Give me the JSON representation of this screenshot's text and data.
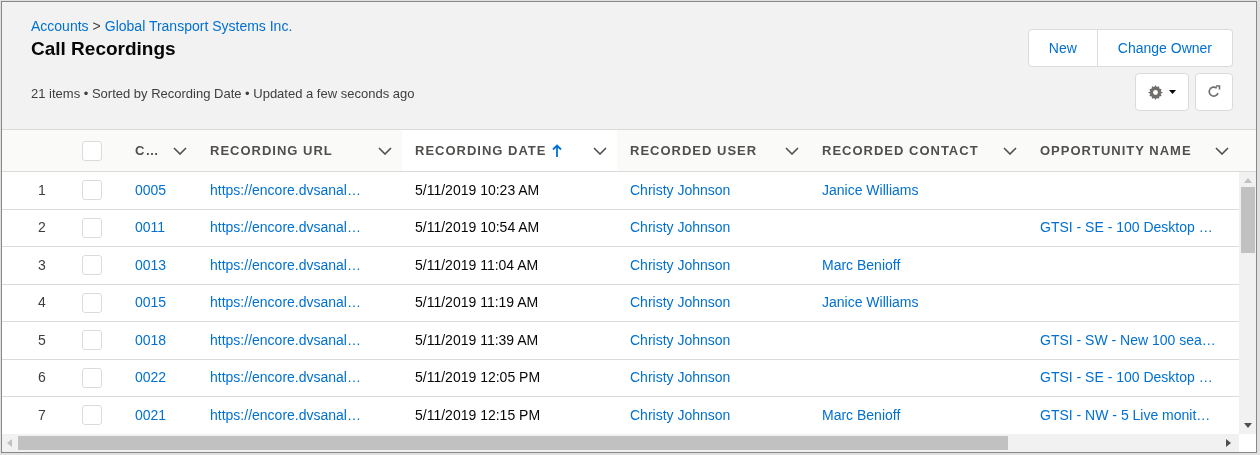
{
  "header": {
    "breadcrumb": [
      {
        "label": "Accounts"
      },
      {
        "label": "Global Transport Systems Inc."
      }
    ],
    "breadcrumb_separator": ">",
    "title": "Call Recordings",
    "summary": "21 items • Sorted by Recording Date • Updated a few seconds ago",
    "buttons": [
      {
        "label": "New"
      },
      {
        "label": "Change Owner"
      }
    ]
  },
  "table": {
    "select_all": {
      "checked": false
    },
    "columns": [
      {
        "label": "C…",
        "sorted": false,
        "kind": "link"
      },
      {
        "label": "RECORDING URL",
        "sorted": false,
        "kind": "link"
      },
      {
        "label": "RECORDING DATE",
        "sorted": true,
        "kind": "text"
      },
      {
        "label": "RECORDED USER",
        "sorted": false,
        "kind": "link"
      },
      {
        "label": "RECORDED CONTACT",
        "sorted": false,
        "kind": "link"
      },
      {
        "label": "OPPORTUNITY NAME",
        "sorted": false,
        "kind": "link"
      }
    ],
    "rows": [
      {
        "number": "1",
        "checked": false,
        "cells": [
          "0005",
          "https://encore.dvsanal…",
          "5/11/2019 10:23 AM",
          "Christy Johnson",
          "Janice Williams",
          null
        ]
      },
      {
        "number": "2",
        "checked": false,
        "cells": [
          "0011",
          "https://encore.dvsanal…",
          "5/11/2019 10:54 AM",
          "Christy Johnson",
          null,
          "GTSI - SE - 100 Desktop …"
        ]
      },
      {
        "number": "3",
        "checked": false,
        "cells": [
          "0013",
          "https://encore.dvsanal…",
          "5/11/2019 11:04 AM",
          "Christy Johnson",
          "Marc Benioff",
          null
        ]
      },
      {
        "number": "4",
        "checked": false,
        "cells": [
          "0015",
          "https://encore.dvsanal…",
          "5/11/2019 11:19 AM",
          "Christy Johnson",
          "Janice Williams",
          null
        ]
      },
      {
        "number": "5",
        "checked": false,
        "cells": [
          "0018",
          "https://encore.dvsanal…",
          "5/11/2019 11:39 AM",
          "Christy Johnson",
          null,
          "GTSI - SW - New 100 sea…"
        ]
      },
      {
        "number": "6",
        "checked": false,
        "cells": [
          "0022",
          "https://encore.dvsanal…",
          "5/11/2019 12:05 PM",
          "Christy Johnson",
          null,
          "GTSI - SE - 100 Desktop …"
        ]
      },
      {
        "number": "7",
        "checked": false,
        "cells": [
          "0021",
          "https://encore.dvsanal…",
          "5/11/2019 12:15 PM",
          "Christy Johnson",
          "Marc Benioff",
          "GTSI - NW - 5 Live monit…"
        ]
      }
    ]
  }
}
